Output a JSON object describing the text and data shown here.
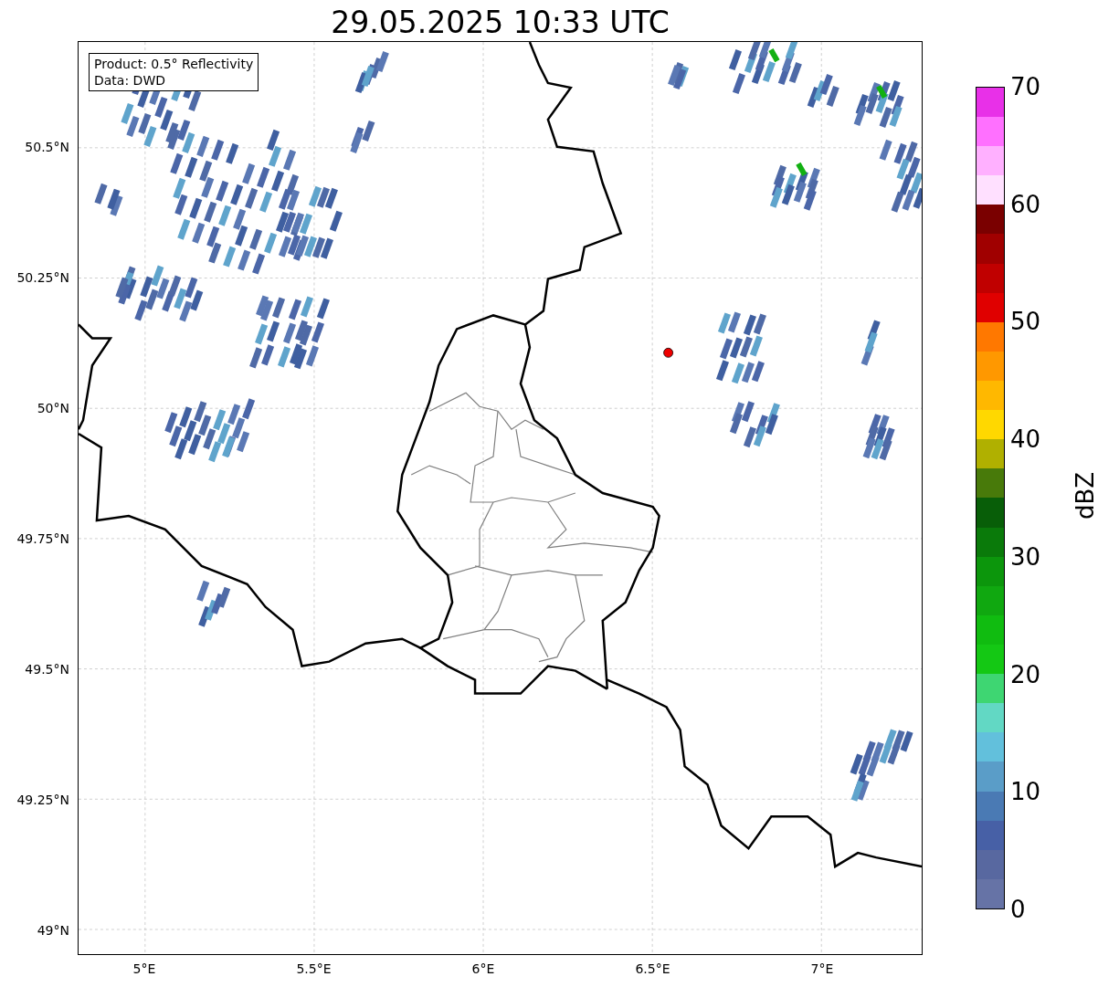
{
  "title": "29.05.2025 10:33 UTC",
  "legend": {
    "lines": [
      "Product: 0.5° Reflectivity",
      "Data: DWD"
    ]
  },
  "map": {
    "lat_ticks": [
      "50.5°N",
      "50.25°N",
      "50°N",
      "49.75°N",
      "49.5°N",
      "49.25°N",
      "49°N"
    ],
    "lon_ticks": [
      "5°E",
      "5.5°E",
      "6°E",
      "6.5°E",
      "7°E"
    ]
  },
  "colorbar": {
    "label": "dBZ",
    "ticks": [
      "70",
      "60",
      "50",
      "40",
      "30",
      "20",
      "10",
      "0"
    ],
    "segments": [
      {
        "color": "#6673a6"
      },
      {
        "color": "#5868a0"
      },
      {
        "color": "#4760a6"
      },
      {
        "color": "#4a7ab4"
      },
      {
        "color": "#5a9dc8"
      },
      {
        "color": "#62c0dc"
      },
      {
        "color": "#62d8c4"
      },
      {
        "color": "#3ed672"
      },
      {
        "color": "#14c814"
      },
      {
        "color": "#10bc10"
      },
      {
        "color": "#10a810"
      },
      {
        "color": "#0c960c"
      },
      {
        "color": "#0a7a0a"
      },
      {
        "color": "#085e08"
      },
      {
        "color": "#487a0a"
      },
      {
        "color": "#b0b000"
      },
      {
        "color": "#ffd800"
      },
      {
        "color": "#ffb800"
      },
      {
        "color": "#ff9800"
      },
      {
        "color": "#ff7800"
      },
      {
        "color": "#e00000"
      },
      {
        "color": "#c00000"
      },
      {
        "color": "#a00000"
      },
      {
        "color": "#7a0000"
      },
      {
        "color": "#ffe0ff"
      },
      {
        "color": "#ffb0ff"
      },
      {
        "color": "#ff70ff"
      },
      {
        "color": "#e830e8"
      }
    ]
  }
}
